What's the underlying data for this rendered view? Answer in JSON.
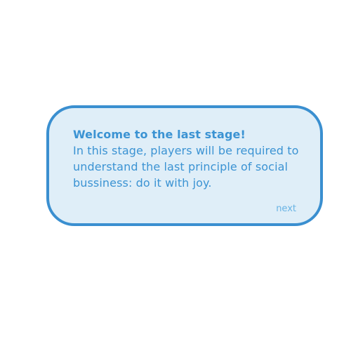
{
  "dialog": {
    "title": "Welcome to the last stage!",
    "body": "In this stage, players will be required to understand the last principle of social bussiness: do it with joy.",
    "next_label": "next"
  },
  "colors": {
    "border": "#3a8fd0",
    "fill": "#dfeef8",
    "text": "#3b93d3",
    "next": "#68b3e4"
  }
}
